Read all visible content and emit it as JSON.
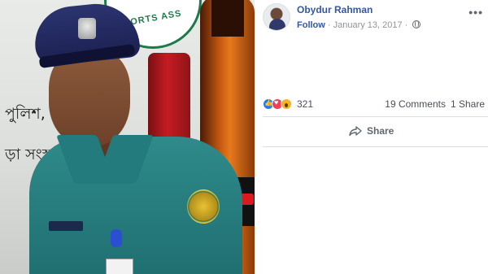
{
  "post": {
    "author": "Obydur Rahman",
    "follow_label": "Follow",
    "separator": " · ",
    "date": "January 13, 2017",
    "privacy_icon": "globe-icon",
    "more_label": "•••",
    "reactions": {
      "icons": [
        "like-icon",
        "love-icon",
        "wow-icon"
      ],
      "count": "321"
    },
    "comments": "19 Comments",
    "shares": "1 Share",
    "share_label": "Share"
  },
  "photo": {
    "banner_line_1": "পুলিশ, সিলে",
    "banner_line_2": "ড়া সংস্থা ।",
    "brand_fragment": "ORTS ASS"
  },
  "colors": {
    "link": "#365899",
    "meta": "#90949c",
    "uniform": "#2f8a8a",
    "cap": "#2c3470"
  }
}
